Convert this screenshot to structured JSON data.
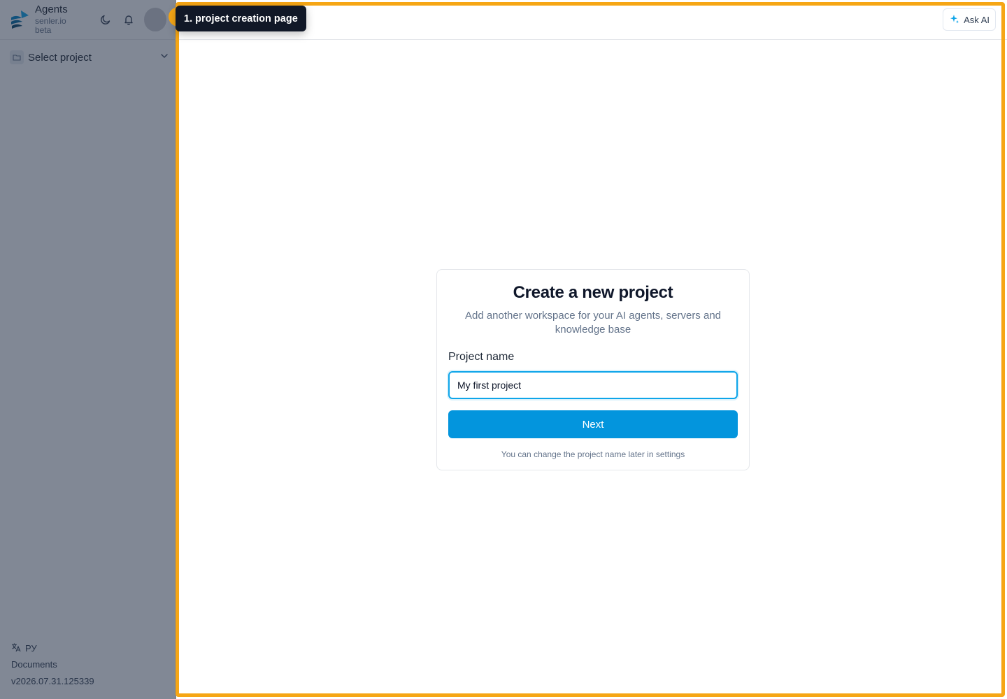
{
  "app": {
    "name": "Agents",
    "subtitle": "senler.io beta"
  },
  "sidebar": {
    "project_select_label": "Select project",
    "footer": {
      "language": "РУ",
      "documents": "Documents",
      "version": "v2026.07.31.125339"
    }
  },
  "topbar": {
    "ask_ai_label": "Ask AI"
  },
  "card": {
    "title": "Create a new project",
    "description": "Add another workspace for your AI agents, servers and knowledge base",
    "field_label": "Project name",
    "input_value": "My first project",
    "next_label": "Next",
    "hint": "You can change the project name later in settings"
  },
  "tour": {
    "tooltip_text": "1. project creation page"
  },
  "colors": {
    "accent": "#0395dd",
    "highlight": "#f6a615",
    "tooltip_bg": "#111827"
  },
  "icons": [
    "logo-icon",
    "moon-icon",
    "bell-icon",
    "folder-icon",
    "chevron-down-icon",
    "translate-icon",
    "sparkle-icon"
  ]
}
